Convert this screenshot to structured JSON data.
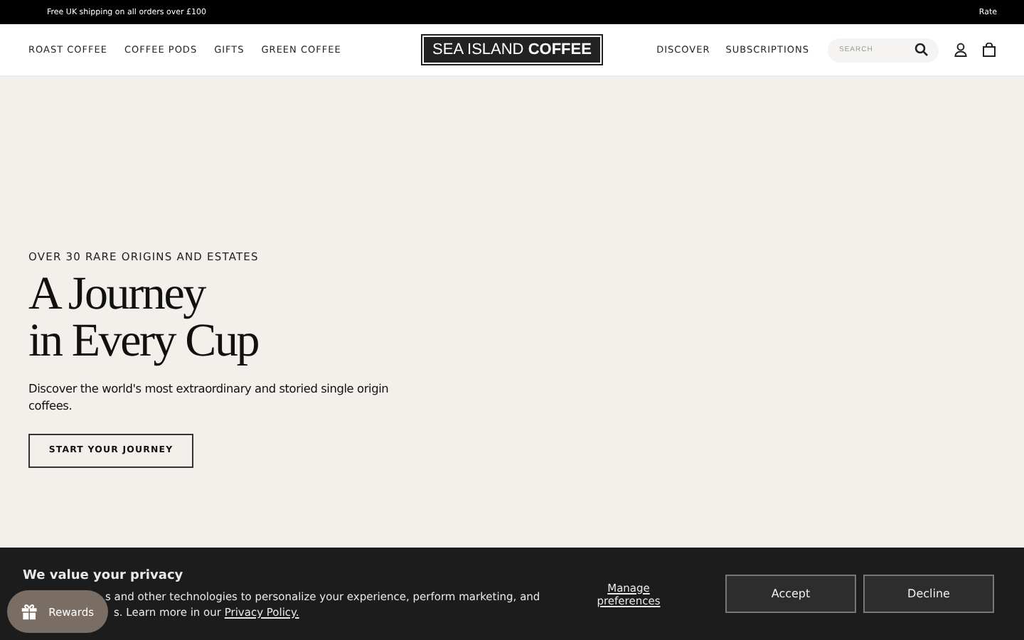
{
  "announcement": {
    "text": "Free UK shipping on all orders over £100",
    "right_text": "Rate"
  },
  "nav_left": [
    "ROAST COFFEE",
    "COFFEE PODS",
    "GIFTS",
    "GREEN COFFEE"
  ],
  "logo": {
    "light": "SEA ISLAND",
    "bold": "COFFEE"
  },
  "nav_right": [
    "DISCOVER",
    "SUBSCRIPTIONS"
  ],
  "search": {
    "placeholder": "SEARCH"
  },
  "hero": {
    "eyebrow": "OVER 30 RARE ORIGINS AND ESTATES",
    "title_lines": [
      "A Journey",
      "in Every Cup"
    ],
    "text": "Discover the world's most extraordinary and storied single origin coffees.",
    "button": "START YOUR JOURNEY"
  },
  "cookie": {
    "title": "We value your privacy",
    "line_1": "s and other technologies to personalize your experience, perform marketing, and",
    "line_2": "s. Learn more in our",
    "link": "Privacy Policy.",
    "manage": "Manage preferences",
    "buttons": [
      "Accept",
      "Decline"
    ]
  },
  "rewards": {
    "label": "Rewards"
  }
}
